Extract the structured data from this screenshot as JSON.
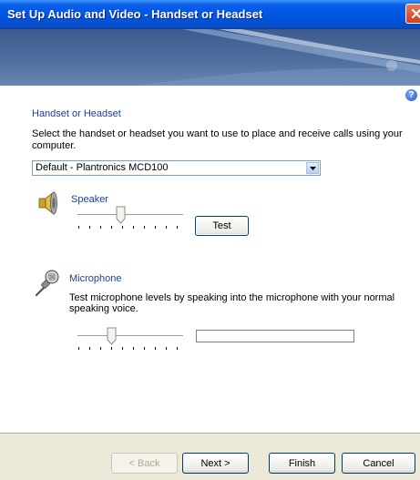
{
  "window": {
    "title": "Set Up Audio and Video - Handset or Headset"
  },
  "help": {
    "glyph": "?"
  },
  "section": {
    "heading": "Handset or Headset",
    "instruction": "Select the handset or headset you want to use to place and receive calls using your computer."
  },
  "device_select": {
    "selected": "Default - Plantronics MCD100"
  },
  "speaker": {
    "label": "Speaker",
    "volume_level": 0.4,
    "test_label": "Test"
  },
  "microphone": {
    "label": "Microphone",
    "instruction": "Test microphone levels by speaking into the microphone with your normal speaking voice.",
    "volume_level": 0.3,
    "input_level": 0
  },
  "buttons": {
    "back": "< Back",
    "next": "Next >",
    "finish": "Finish",
    "cancel": "Cancel"
  },
  "colors": {
    "titlebar": "#0058E6",
    "heading_text": "#1C3F94",
    "dialog_bg": "#ECE9D8",
    "close_button": "#D1401F"
  },
  "icons": {
    "speaker": "speaker-icon",
    "microphone": "microphone-icon",
    "help": "help-icon",
    "close": "close-icon",
    "dropdown": "chevron-down-icon"
  }
}
